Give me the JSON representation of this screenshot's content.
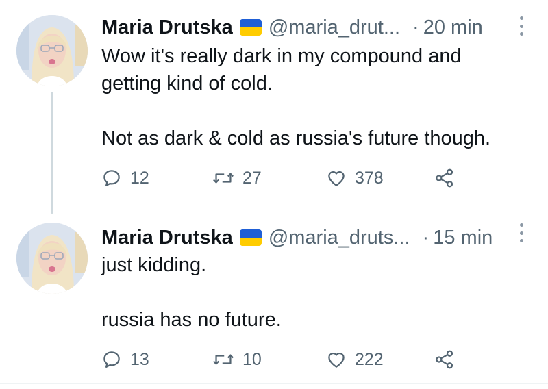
{
  "tweets": [
    {
      "author": {
        "name": "Maria Drutska",
        "handle": "@maria_drut...",
        "flag": "ukraine-flag-emoji"
      },
      "separator": "·",
      "time": "20 min",
      "lines": [
        "Wow it's really dark in my compound and",
        "getting kind of cold.",
        "",
        "Not as dark & cold as russia's future though."
      ],
      "stats": {
        "replies": "12",
        "retweets": "27",
        "likes": "378"
      }
    },
    {
      "author": {
        "name": "Maria Drutska",
        "handle": "@maria_druts...",
        "flag": "ukraine-flag-emoji"
      },
      "separator": "·",
      "time": "15 min",
      "lines": [
        "just kidding.",
        "",
        "russia has no future."
      ],
      "stats": {
        "replies": "13",
        "retweets": "10",
        "likes": "222"
      }
    }
  ],
  "colors": {
    "text_primary": "#0f1419",
    "text_secondary": "#536471",
    "thread_line": "#cfd9de",
    "flag_blue": "#1f5fd6",
    "flag_yellow": "#ffcc00"
  }
}
